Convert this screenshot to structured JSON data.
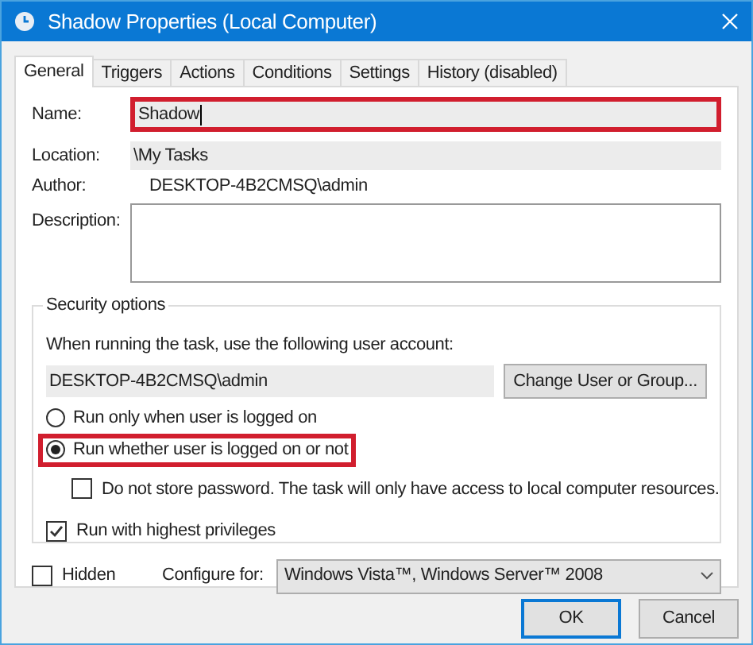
{
  "window": {
    "title": "Shadow Properties (Local Computer)"
  },
  "tabs": [
    {
      "label": "General",
      "selected": true
    },
    {
      "label": "Triggers",
      "selected": false
    },
    {
      "label": "Actions",
      "selected": false
    },
    {
      "label": "Conditions",
      "selected": false
    },
    {
      "label": "Settings",
      "selected": false
    },
    {
      "label": "History (disabled)",
      "selected": false
    }
  ],
  "fields": {
    "name": {
      "label": "Name:",
      "value": "Shadow",
      "highlighted": true
    },
    "location": {
      "label": "Location:",
      "value": "\\My Tasks"
    },
    "author": {
      "label": "Author:",
      "value": "DESKTOP-4B2CMSQ\\admin"
    },
    "description": {
      "label": "Description:"
    }
  },
  "security": {
    "title": "Security options",
    "prompt": "When running the task, use the following user account:",
    "account": "DESKTOP-4B2CMSQ\\admin",
    "change_button": "Change User or Group...",
    "options": [
      {
        "kind": "radio",
        "label": "Run only when user is logged on",
        "selected": false,
        "highlighted": false
      },
      {
        "kind": "radio",
        "label": "Run whether user is logged on or not",
        "selected": true,
        "highlighted": true
      },
      {
        "kind": "sub_checkbox",
        "label": "Do not store password.  The task will only have access to local computer resources.",
        "checked": false
      },
      {
        "kind": "checkbox",
        "label": "Run with highest privileges",
        "checked": true
      }
    ]
  },
  "hidden": {
    "label": "Hidden",
    "checked": false
  },
  "configure": {
    "label": "Configure for:",
    "value": "Windows Vista™, Windows Server™ 2008"
  },
  "buttons": [
    {
      "label": "OK",
      "default": true
    },
    {
      "label": "Cancel",
      "default": false
    }
  ]
}
